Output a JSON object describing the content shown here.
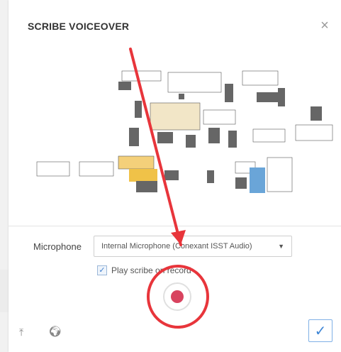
{
  "dialog": {
    "title": "SCRIBE VOICEOVER",
    "close_icon": "close-icon"
  },
  "microphone": {
    "label": "Microphone",
    "selected": "Internal Microphone (Conexant ISST Audio)"
  },
  "play_scribe": {
    "label": "Play scribe on record",
    "checked": true
  },
  "footer": {
    "upload_icon": "upload-icon",
    "globe_icon": "globe-icon",
    "confirm_icon": "check-icon"
  },
  "colors": {
    "record": "#d8435f",
    "annotation": "#e8353b",
    "accent": "#3f86d6"
  }
}
